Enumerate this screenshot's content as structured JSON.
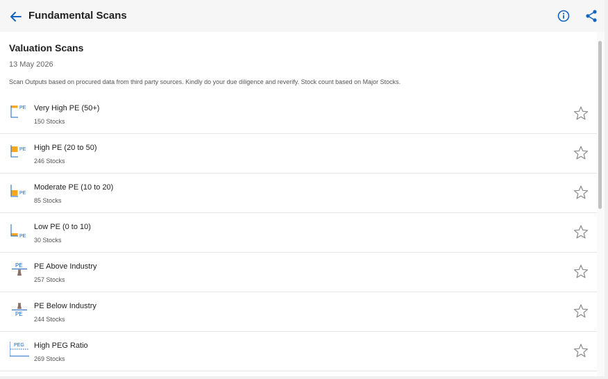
{
  "header": {
    "title": "Fundamental Scans"
  },
  "section": {
    "title": "Valuation Scans",
    "date": "13 May 2026",
    "disclaimer": "Scan Outputs based on procured data from third party sources. Kindly do your due diligence and reverify. Stock count based on Major Stocks."
  },
  "colors": {
    "accent": "#1565c0",
    "orange": "#f5a623",
    "star": "#888888"
  },
  "scans": [
    {
      "name": "Very High PE (50+)",
      "count": "150 Stocks",
      "icon_label": "PE",
      "icon": "very-high-pe-icon"
    },
    {
      "name": "High PE (20 to 50)",
      "count": "246 Stocks",
      "icon_label": "PE",
      "icon": "high-pe-icon"
    },
    {
      "name": "Moderate PE (10 to 20)",
      "count": "85 Stocks",
      "icon_label": "PE",
      "icon": "moderate-pe-icon"
    },
    {
      "name": "Low PE (0 to 10)",
      "count": "30 Stocks",
      "icon_label": "PE",
      "icon": "low-pe-icon"
    },
    {
      "name": "PE Above Industry",
      "count": "257 Stocks",
      "icon_label": "PE",
      "icon": "pe-above-industry-icon"
    },
    {
      "name": "PE Below Industry",
      "count": "244 Stocks",
      "icon_label": "PE",
      "icon": "pe-below-industry-icon"
    },
    {
      "name": "High PEG Ratio",
      "count": "269 Stocks",
      "icon_label": "PEG",
      "icon": "high-peg-icon"
    }
  ]
}
